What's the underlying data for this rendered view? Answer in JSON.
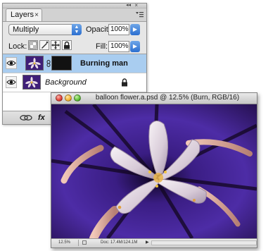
{
  "layers_panel": {
    "tab_label": "Layers",
    "tab_close": "×",
    "collapse_glyph": "◂◂",
    "close_glyph": "×",
    "blend_mode": "Multiply",
    "opacity_label": "Opacity:",
    "opacity_value": "100%",
    "lock_label": "Lock:",
    "fill_label": "Fill:",
    "fill_value": "100%",
    "layers": [
      {
        "name": "Burning man",
        "visible": true,
        "has_mask": true,
        "selected": true
      },
      {
        "name": "Background",
        "visible": true,
        "locked": true,
        "selected": false
      }
    ],
    "fx_label": "fx"
  },
  "document": {
    "title": "balloon flower.a.psd @ 12.5% (Burn, RGB/16)",
    "zoom": "12.5%",
    "doc_size": "Doc: 17.4M/124.1M"
  },
  "colors": {
    "selection_blue": "#a9cdf0",
    "accent_blue": "#2c6fd0",
    "flower_purple": "#3f1f78"
  },
  "icons": [
    "eye-icon",
    "chain-link-icon",
    "lock-icon",
    "lock-transparent-icon",
    "lock-image-icon",
    "lock-position-icon",
    "lock-all-icon",
    "link-layers-icon",
    "panel-menu-icon"
  ]
}
